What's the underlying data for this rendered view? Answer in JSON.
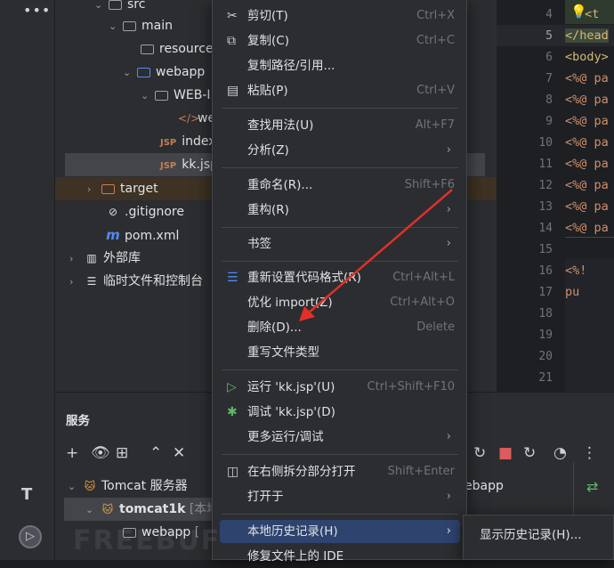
{
  "tree": {
    "items": [
      {
        "label": "src",
        "indent": 44,
        "arrow": "⌄"
      },
      {
        "label": "main",
        "indent": 60,
        "arrow": "⌄"
      },
      {
        "label": "resources",
        "indent": 92,
        "arrow": ""
      },
      {
        "label": "webapp",
        "indent": 76,
        "arrow": "⌄"
      },
      {
        "label": "WEB-I",
        "indent": 92,
        "arrow": "⌄"
      },
      {
        "label": "we",
        "indent": 130,
        "arrow": ""
      },
      {
        "label": "index.",
        "indent": 116,
        "arrow": ""
      },
      {
        "label": "kk.jsp",
        "indent": 116,
        "arrow": ""
      },
      {
        "label": "target",
        "indent": 40,
        "arrow": "›"
      },
      {
        "label": ".gitignore",
        "indent": 54,
        "arrow": ""
      },
      {
        "label": "pom.xml",
        "indent": 54,
        "arrow": ""
      },
      {
        "label": "外部库",
        "indent": 16,
        "arrow": "›"
      },
      {
        "label": "临时文件和控制台",
        "indent": 16,
        "arrow": "›"
      }
    ],
    "jsp_tag": "JSP"
  },
  "editor": {
    "line_numbers": [
      "4",
      "5",
      "6",
      "7",
      "8",
      "9",
      "10",
      "11",
      "12",
      "13",
      "14",
      "15",
      "16",
      "17",
      "18",
      "19",
      "20",
      "21"
    ],
    "code_lines": [
      "<t",
      "</head",
      "<body>",
      "<%@ pa",
      "<%@ pa",
      "<%@ pa",
      "<%@ pa",
      "<%@ pa",
      "<%@ pa",
      "<%@ pa",
      "<%@ pa",
      "",
      "<%!",
      "    pu"
    ]
  },
  "services": {
    "title": "服务",
    "tomcat_group": "Tomcat 服务器",
    "server": "tomcat1k",
    "server_status": "[本地]",
    "artifact": "webapp",
    "artifact_tail": "[",
    "right_artifact": "ebapp"
  },
  "menu": {
    "items": [
      {
        "label": "剪切(T)",
        "shortcut": "Ctrl+X",
        "icon": "✂"
      },
      {
        "label": "复制(C)",
        "shortcut": "Ctrl+C",
        "icon": "⧉"
      },
      {
        "label": "复制路径/引用...",
        "shortcut": "",
        "icon": ""
      },
      {
        "label": "粘贴(P)",
        "shortcut": "Ctrl+V",
        "icon": "📋"
      },
      {
        "label": "查找用法(U)",
        "shortcut": "Alt+F7",
        "icon": ""
      },
      {
        "label": "分析(Z)",
        "shortcut": "",
        "icon": "",
        "sub": true
      },
      {
        "label": "重命名(R)...",
        "shortcut": "Shift+F6",
        "icon": ""
      },
      {
        "label": "重构(R)",
        "shortcut": "",
        "icon": "",
        "sub": true
      },
      {
        "label": "书签",
        "shortcut": "",
        "icon": "",
        "sub": true
      },
      {
        "label": "重新设置代码格式(R)",
        "shortcut": "Ctrl+Alt+L",
        "icon": "☰"
      },
      {
        "label": "优化 import(Z)",
        "shortcut": "Ctrl+Alt+O",
        "icon": ""
      },
      {
        "label": "删除(D)...",
        "shortcut": "Delete",
        "icon": ""
      },
      {
        "label": "重写文件类型",
        "shortcut": "",
        "icon": ""
      },
      {
        "label": "运行 'kk.jsp'(U)",
        "shortcut": "Ctrl+Shift+F10",
        "icon": "▷"
      },
      {
        "label": "调试 'kk.jsp'(D)",
        "shortcut": "",
        "icon": "🐞"
      },
      {
        "label": "更多运行/调试",
        "shortcut": "",
        "icon": "",
        "sub": true
      },
      {
        "label": "在右侧拆分部分打开",
        "shortcut": "Shift+Enter",
        "icon": "◫"
      },
      {
        "label": "打开于",
        "shortcut": "",
        "icon": "",
        "sub": true
      },
      {
        "label": "本地历史记录(H)",
        "shortcut": "",
        "icon": "",
        "sub": true
      },
      {
        "label": "修复文件上的 IDE",
        "shortcut": "",
        "icon": ""
      }
    ]
  },
  "submenu": {
    "label": "显示历史记录(H)..."
  },
  "watermark": "FREEBUF",
  "colors": {
    "accent": "#2e436e",
    "arrow": "#e0302a",
    "run": "#5fb865"
  }
}
